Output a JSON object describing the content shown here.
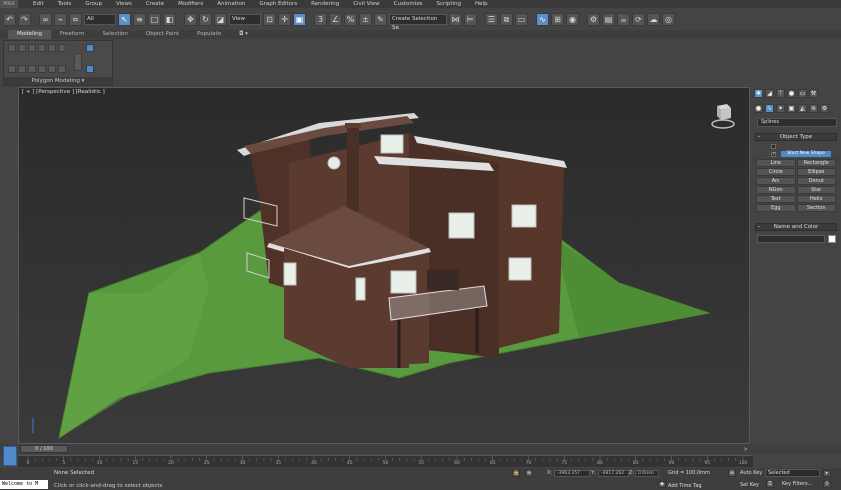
{
  "menubar": {
    "items": [
      "Edit",
      "Tools",
      "Group",
      "Views",
      "Create",
      "Modifiers",
      "Animation",
      "Graph Editors",
      "Rendering",
      "Civil View",
      "Customize",
      "Scripting",
      "Help"
    ]
  },
  "toolbar": {
    "selection_filter": "All",
    "ref_coord": "View",
    "named_selection": "Create Selection Se"
  },
  "ribbon": {
    "tabs": [
      "Modeling",
      "Freeform",
      "Selection",
      "Object Paint",
      "Populate"
    ],
    "active_tab": "Modeling",
    "panel_label": "Polygon Modeling"
  },
  "viewport": {
    "label": "[ + ] [Perspective ] [Realistic ]"
  },
  "command_panel": {
    "category": "Splines",
    "object_type_title": "Object Type",
    "autogrid_label": "AutoGrid",
    "start_new_shape": "Start New Shape",
    "shapes": [
      "Line",
      "Rectangle",
      "Circle",
      "Ellipse",
      "Arc",
      "Donut",
      "NGon",
      "Star",
      "Text",
      "Helix",
      "Egg",
      "Section"
    ],
    "name_color_title": "Name and Color"
  },
  "timeslider": {
    "frame_text": "0 / 100",
    "ticks": [
      "0",
      "5",
      "10",
      "15",
      "20",
      "25",
      "30",
      "35",
      "40",
      "45",
      "50",
      "55",
      "60",
      "65",
      "70",
      "75",
      "80",
      "85",
      "90",
      "95",
      "100"
    ]
  },
  "status": {
    "maxscript": "Welcome to M",
    "selection": "None Selected",
    "prompt": "Click or click-and-drag to select objects",
    "x_label": "X:",
    "x_value": "-3963.357",
    "y_label": "Y:",
    "y_value": "-4817.262",
    "z_label": "Z:",
    "z_value": "0.0mm",
    "grid": "Grid = 100.0mm",
    "add_time_tag": "Add Time Tag",
    "auto_key": "Auto Key",
    "set_key": "Set Key",
    "selected": "Selected",
    "key_filters": "Key Filters..."
  },
  "colors": {
    "accent": "#4f8bc9",
    "brick": "#5b3a30",
    "roof": "#6b4a40",
    "grass": "#5a9a3e"
  }
}
